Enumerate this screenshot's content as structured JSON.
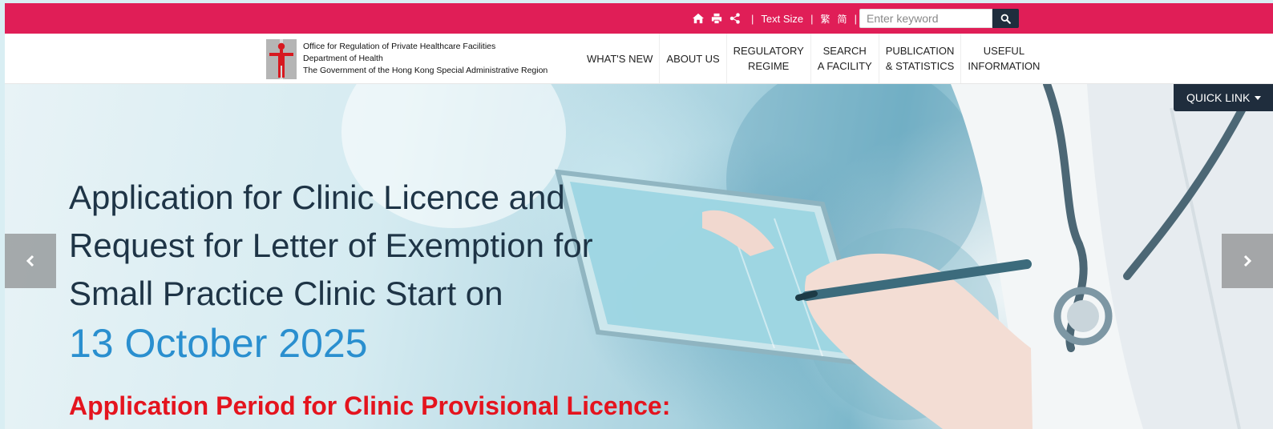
{
  "topbar": {
    "icons": [
      "home-icon",
      "print-icon",
      "share-icon"
    ],
    "text_size_label": "Text Size",
    "lang_traditional": "繁",
    "lang_simplified": "简",
    "search_placeholder": "Enter keyword",
    "search_icon": "search-icon"
  },
  "header": {
    "org_line1": "Office for Regulation of Private Healthcare Facilities",
    "org_line2": "Department of Health",
    "org_line3": "The Government of the Hong Kong Special Administrative Region",
    "nav": [
      {
        "line1": "WHAT'S NEW",
        "line2": ""
      },
      {
        "line1": "ABOUT US",
        "line2": ""
      },
      {
        "line1": "REGULATORY",
        "line2": "REGIME"
      },
      {
        "line1": "SEARCH",
        "line2": "A FACILITY"
      },
      {
        "line1": "PUBLICATION",
        "line2": "& STATISTICS"
      },
      {
        "line1": "USEFUL",
        "line2": "INFORMATION"
      }
    ]
  },
  "hero": {
    "title_line1": "Application for Clinic Licence and",
    "title_line2": "Request for Letter of Exemption for",
    "title_line3": "Small Practice Clinic Start on",
    "date": "13 October 2025",
    "subtitle": "Application Period for Clinic Provisional Licence:",
    "quick_link_label": "QUICK LINK"
  },
  "colors": {
    "brand_red": "#e01e57",
    "dark_navy": "#1f2d3d",
    "title_text": "#1e3446",
    "date_blue": "#2a8fcf",
    "subtitle_red": "#e4141e"
  }
}
